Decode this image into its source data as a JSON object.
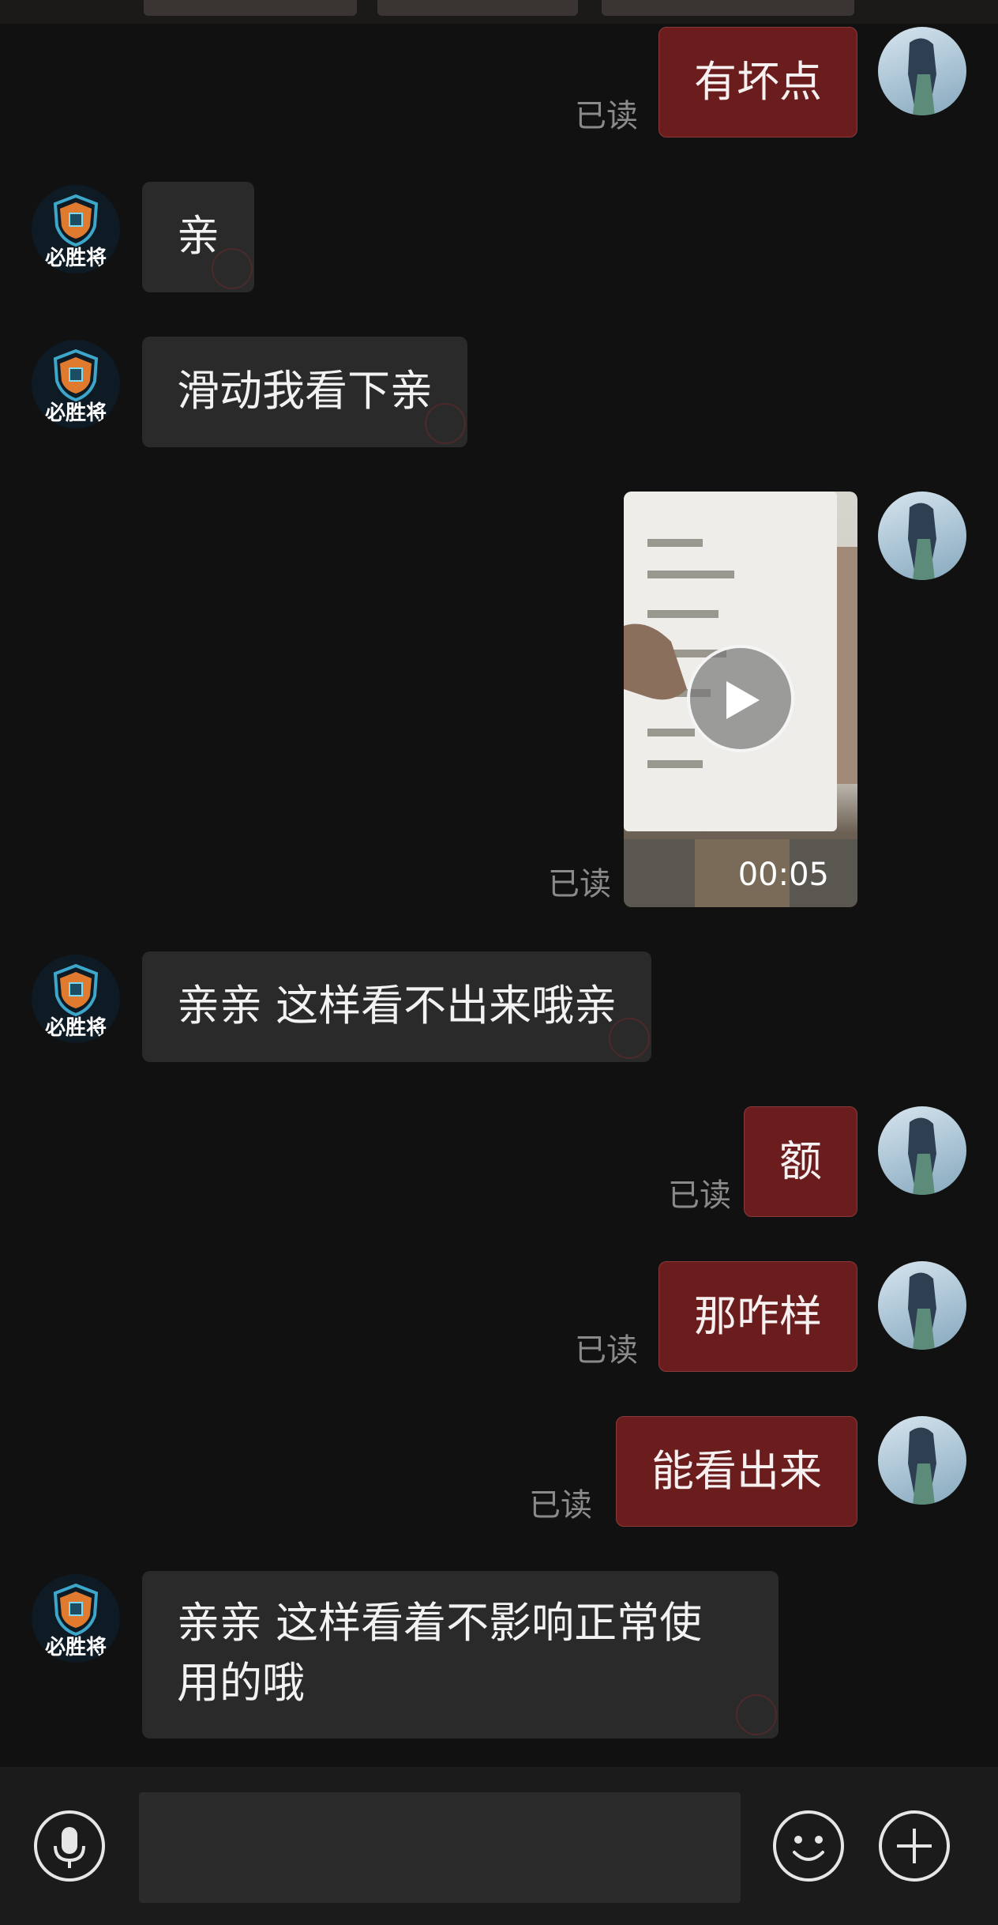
{
  "messages": [
    {
      "side": "out",
      "text": "有坏点",
      "read": "已读"
    },
    {
      "side": "in",
      "text": "亲"
    },
    {
      "side": "in",
      "text": "滑动我看下亲"
    },
    {
      "side": "out",
      "type": "video",
      "duration": "00:05",
      "read": "已读"
    },
    {
      "side": "in",
      "text": "亲亲 这样看不出来哦亲"
    },
    {
      "side": "out",
      "text": "额",
      "read": "已读"
    },
    {
      "side": "out",
      "text": "那咋样",
      "read": "已读"
    },
    {
      "side": "out",
      "text": "能看出来",
      "read": "已读"
    },
    {
      "side": "in",
      "text": "亲亲 这样看着不影响正常使用的哦"
    }
  ],
  "shop": {
    "avatar_text": "必胜将"
  },
  "input": {
    "placeholder": ""
  },
  "icons": {
    "voice": "microphone-icon",
    "emoji": "smiley-icon",
    "more": "plus-icon",
    "play": "play-icon"
  }
}
